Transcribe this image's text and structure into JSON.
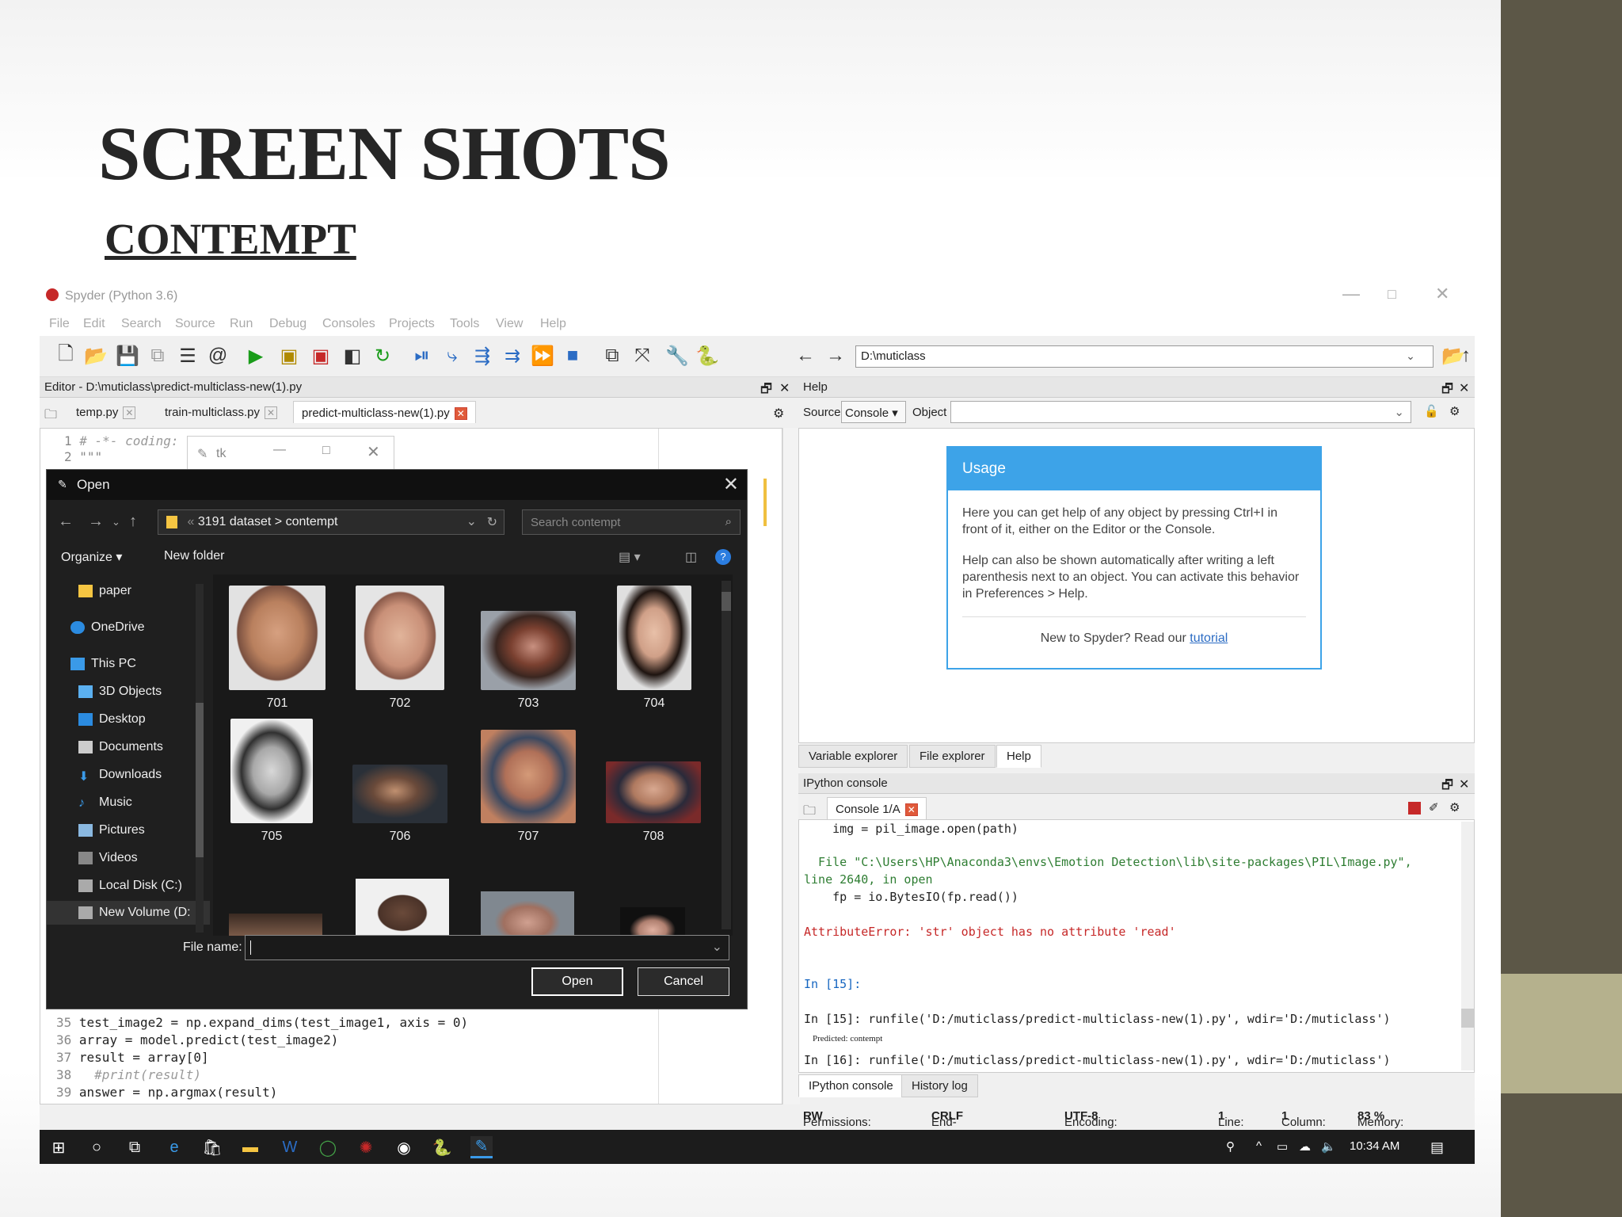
{
  "slide": {
    "title": "SCREEN SHOTS",
    "subtitle": "CONTEMPT",
    "colors": {
      "sidebar": "#5c5747",
      "accent": "#b5b18d",
      "title": "#262626"
    }
  },
  "window": {
    "title": "Spyder (Python 3.6)",
    "controls": [
      "—",
      "□",
      "✕"
    ]
  },
  "menu": [
    "File",
    "Edit",
    "Search",
    "Source",
    "Run",
    "Debug",
    "Consoles",
    "Projects",
    "Tools",
    "View",
    "Help"
  ],
  "toolbar": {
    "path": "D:\\muticlass"
  },
  "editor": {
    "header": "Editor - D:\\muticlass\\predict-multiclass-new(1).py",
    "tabs": [
      "temp.py",
      "train-multiclass.py",
      "predict-multiclass-new(1).py"
    ],
    "top_lines": [
      {
        "num": "1",
        "text": "# -*- coding: "
      },
      {
        "num": "2",
        "text": "\"\"\""
      }
    ],
    "bottom_lines": [
      {
        "num": "35",
        "text": "test_image2 = np.expand_dims(test_image1, axis = 0)"
      },
      {
        "num": "36",
        "text": "array = model.predict(test_image2)"
      },
      {
        "num": "37",
        "text": "result = array[0]"
      },
      {
        "num": "38",
        "text": "  #print(result)"
      },
      {
        "num": "39",
        "text": "answer = np.argmax(result)"
      }
    ]
  },
  "tk_window": {
    "title": "tk"
  },
  "help": {
    "header": "Help",
    "source_label": "Source",
    "source_value": "Console",
    "object_label": "Object",
    "usage_title": "Usage",
    "usage_p1": "Here you can get help of any object by pressing Ctrl+I in front of it, either on the Editor or the Console.",
    "usage_p2": "Help can also be shown automatically after writing a left parenthesis next to an object. You can activate this behavior in Preferences > Help.",
    "usage_p3_prefix": "New to Spyder? Read our ",
    "usage_link": "tutorial",
    "tabs": [
      "Variable explorer",
      "File explorer",
      "Help"
    ]
  },
  "console": {
    "header": "IPython console",
    "tab": "Console 1/A",
    "lines": [
      "    img = pil_image.open(path)",
      "",
      "  File \"C:\\Users\\HP\\Anaconda3\\envs\\Emotion Detection\\lib\\site-packages\\PIL\\Image.py\",",
      "line 2640, in open",
      "    fp = io.BytesIO(fp.read())",
      "",
      "AttributeError: 'str' object has no attribute 'read'",
      "",
      "",
      "In [15]:",
      "",
      "In [15]: runfile('D:/muticlass/predict-multiclass-new(1).py', wdir='D:/muticlass')",
      "    Predicted: contempt",
      "In [16]: runfile('D:/muticlass/predict-multiclass-new(1).py', wdir='D:/muticlass')"
    ],
    "tabs": [
      "IPython console",
      "History log"
    ]
  },
  "status": {
    "permissions_label": "Permissions:",
    "permissions": "RW",
    "eol_label": "End-of-lines:",
    "eol": "CRLF",
    "encoding_label": "Encoding:",
    "encoding": "UTF-8",
    "line_label": "Line:",
    "line": "1",
    "column_label": "Column:",
    "column": "1",
    "memory_label": "Memory:",
    "memory": "83 %"
  },
  "dialog": {
    "title": "Open",
    "breadcrumb_root": "3191 dataset",
    "breadcrumb_sep": ">",
    "breadcrumb_leaf": "contempt",
    "search_placeholder": "Search contempt",
    "organize": "Organize",
    "new_folder": "New folder",
    "nav": [
      "paper",
      "OneDrive",
      "This PC",
      "3D Objects",
      "Desktop",
      "Documents",
      "Downloads",
      "Music",
      "Pictures",
      "Videos",
      "Local Disk (C:)",
      "New Volume (D:"
    ],
    "files": [
      "701",
      "702",
      "703",
      "704",
      "705",
      "706",
      "707",
      "708"
    ],
    "filename_label": "File name:",
    "open_btn": "Open",
    "cancel_btn": "Cancel"
  },
  "taskbar": {
    "time": "10:34 AM"
  }
}
